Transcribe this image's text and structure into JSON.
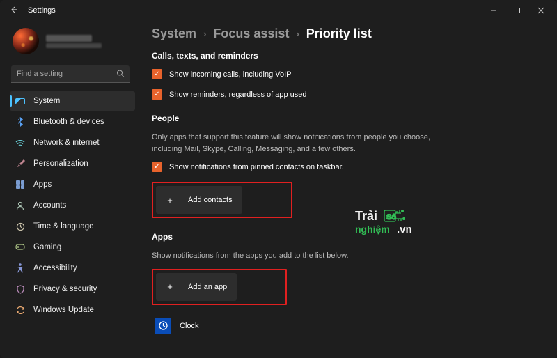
{
  "window": {
    "title": "Settings"
  },
  "profile": {},
  "search": {
    "placeholder": "Find a setting"
  },
  "sidebar": {
    "items": [
      {
        "label": "System",
        "active": true
      },
      {
        "label": "Bluetooth & devices"
      },
      {
        "label": "Network & internet"
      },
      {
        "label": "Personalization"
      },
      {
        "label": "Apps"
      },
      {
        "label": "Accounts"
      },
      {
        "label": "Time & language"
      },
      {
        "label": "Gaming"
      },
      {
        "label": "Accessibility"
      },
      {
        "label": "Privacy & security"
      },
      {
        "label": "Windows Update"
      }
    ]
  },
  "breadcrumb": {
    "part1": "System",
    "part2": "Focus assist",
    "part3": "Priority list"
  },
  "calls": {
    "heading": "Calls, texts, and reminders",
    "opt1": "Show incoming calls, including VoIP",
    "opt2": "Show reminders, regardless of app used"
  },
  "people": {
    "heading": "People",
    "desc": "Only apps that support this feature will show notifications from people you choose, including Mail, Skype, Calling, Messaging, and a few others.",
    "opt1": "Show notifications from pinned contacts on taskbar.",
    "add_btn": "Add contacts"
  },
  "apps": {
    "heading": "Apps",
    "desc": "Show notifications from the apps you add to the list below.",
    "add_btn": "Add an app",
    "item1": "Clock"
  }
}
